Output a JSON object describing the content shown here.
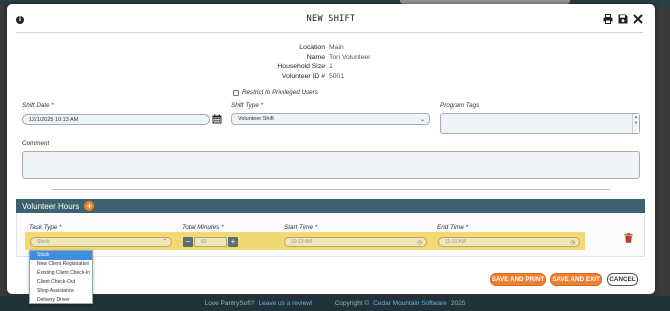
{
  "modal": {
    "title": "NEW SHIFT",
    "icons": [
      "info-icon",
      "print-icon",
      "save-icon",
      "close-icon"
    ]
  },
  "info": [
    {
      "label": "Location",
      "value": "Main"
    },
    {
      "label": "Name",
      "value": "Tori Volunteer"
    },
    {
      "label": "Household Size",
      "value": "1"
    },
    {
      "label": "Volunteer ID #",
      "value": "5001"
    }
  ],
  "restrict_label": "Restrict to Privileged Users",
  "shift_date": {
    "label": "Shift Date *",
    "value": "12/1/2025 10:13 AM"
  },
  "shift_type": {
    "label": "Shift Type *",
    "value": "Volunteer Shift"
  },
  "program_tags": {
    "label": "Program Tags"
  },
  "comment": {
    "label": "Comment"
  },
  "volunteer_hours": {
    "title": "Volunteer Hours",
    "task_type": {
      "label": "Task Type *",
      "placeholder": "Stock"
    },
    "total_minutes": {
      "label": "Total Minutes *",
      "value": "60"
    },
    "start_time": {
      "label": "Start Time *",
      "value": "10:13 AM"
    },
    "end_time": {
      "label": "End Time *",
      "value": "11:13 AM"
    }
  },
  "dropdown_options": [
    "Stock",
    "New Client Registration",
    "Existing Client Check-In",
    "Client Check-Out",
    "Shop Assistance",
    "Delivery Driver"
  ],
  "buttons": {
    "save_print": "SAVE AND PRINT",
    "save_exit": "SAVE AND EXIT",
    "cancel": "CANCEL"
  },
  "footer": {
    "love": "Love PantrySoft?",
    "review": "Leave us a review!",
    "copyright_prefix": "Copyright ©",
    "company": "Cedar Mountain Software",
    "year": "2025"
  },
  "colors": {
    "accent": "#f0802f",
    "header_bar": "#3c6270",
    "row_highlight": "#f1d873",
    "selected_option": "#3d8de0"
  }
}
